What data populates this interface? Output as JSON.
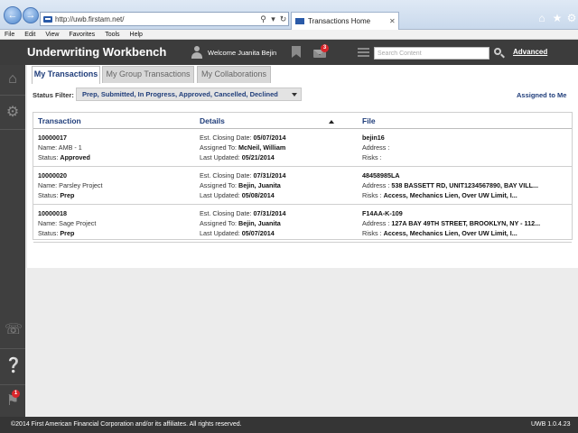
{
  "browser": {
    "url": "http://uwb.firstam.net/",
    "tab_title": "Transactions Home"
  },
  "menu": [
    "File",
    "Edit",
    "View",
    "Favorites",
    "Tools",
    "Help"
  ],
  "header": {
    "title": "Underwriting Workbench",
    "welcome": "Welcome Juanita Bejin",
    "mail_count": "3",
    "search_placeholder": "Search Content",
    "advanced_label": "Advanced"
  },
  "sidebar": {
    "notification_count": "1"
  },
  "tabs": [
    "My Transactions",
    "My Group Transactions",
    "My Collaborations"
  ],
  "filter": {
    "label": "Status Filter:",
    "value": "Prep, Submitted, In Progress, Approved, Cancelled, Declined",
    "assigned_link": "Assigned to Me"
  },
  "table": {
    "headers": [
      "Transaction",
      "Details",
      "File"
    ],
    "rows": [
      {
        "id": "10000017",
        "name_label": "Name:",
        "name": "AMB - 1",
        "status_label": "Status:",
        "status": "Approved",
        "closing_label": "Est. Closing Date:",
        "closing": "05/07/2014",
        "assigned_label": "Assigned To:",
        "assigned": "McNeil, William",
        "updated_label": "Last Updated:",
        "updated": "05/21/2014",
        "file": "bejin16",
        "address_label": "Address :",
        "address": "",
        "risks_label": "Risks :",
        "risks": ""
      },
      {
        "id": "10000020",
        "name_label": "Name:",
        "name": "Parsley Project",
        "status_label": "Status:",
        "status": "Prep",
        "closing_label": "Est. Closing Date:",
        "closing": "07/31/2014",
        "assigned_label": "Assigned To:",
        "assigned": "Bejin, Juanita",
        "updated_label": "Last Updated:",
        "updated": "05/08/2014",
        "file": "48458985LA",
        "address_label": "Address :",
        "address": "538 BASSETT RD, UNIT1234567890, BAY VILL...",
        "risks_label": "Risks :",
        "risks": "Access, Mechanics Lien, Over UW Limit, I..."
      },
      {
        "id": "10000018",
        "name_label": "Name:",
        "name": "Sage Project",
        "status_label": "Status:",
        "status": "Prep",
        "closing_label": "Est. Closing Date:",
        "closing": "07/31/2014",
        "assigned_label": "Assigned To:",
        "assigned": "Bejin, Juanita",
        "updated_label": "Last Updated:",
        "updated": "05/07/2014",
        "file": "F14AA-K-109",
        "address_label": "Address :",
        "address": "127A BAY 49TH STREET, BROOKLYN, NY - 112...",
        "risks_label": "Risks :",
        "risks": "Access, Mechanics Lien, Over UW Limit, I..."
      }
    ]
  },
  "footer": {
    "copyright": "©2014 First American Financial Corporation and/or its affiliates. All rights reserved.",
    "version": "UWB 1.0.4.23"
  },
  "colors": {
    "header_bg": "#3c3c3c",
    "link_blue": "#1f3d7a",
    "badge_red": "#d9262b"
  }
}
